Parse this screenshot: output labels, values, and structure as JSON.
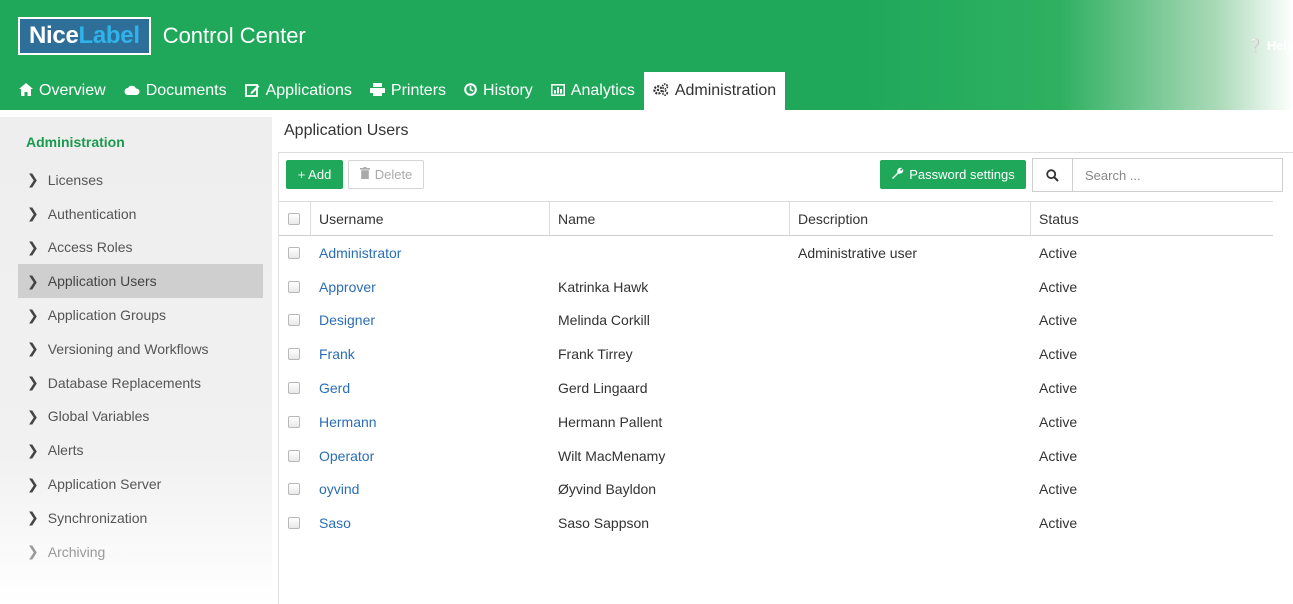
{
  "header": {
    "logo_part1": "Nice",
    "logo_part2": "Label",
    "app_title": "Control Center",
    "help_label": "Help",
    "colors": {
      "brand_green": "#1fa85a",
      "logo_blue": "#2e6f9a",
      "logo_cyan": "#2fb3e8"
    }
  },
  "nav": {
    "tabs": [
      {
        "label": "Overview",
        "icon": "home-icon"
      },
      {
        "label": "Documents",
        "icon": "cloud-icon"
      },
      {
        "label": "Applications",
        "icon": "edit-icon"
      },
      {
        "label": "Printers",
        "icon": "printer-icon"
      },
      {
        "label": "History",
        "icon": "clock-icon"
      },
      {
        "label": "Analytics",
        "icon": "chart-icon"
      },
      {
        "label": "Administration",
        "icon": "gears-icon",
        "active": true
      }
    ]
  },
  "sidebar": {
    "title": "Administration",
    "items": [
      {
        "label": "Licenses"
      },
      {
        "label": "Authentication"
      },
      {
        "label": "Access Roles"
      },
      {
        "label": "Application Users",
        "active": true
      },
      {
        "label": "Application Groups"
      },
      {
        "label": "Versioning and Workflows"
      },
      {
        "label": "Database Replacements"
      },
      {
        "label": "Global Variables"
      },
      {
        "label": "Alerts"
      },
      {
        "label": "Application Server"
      },
      {
        "label": "Synchronization"
      },
      {
        "label": "Archiving",
        "disabled": true
      }
    ]
  },
  "main": {
    "title": "Application Users",
    "toolbar": {
      "add_label": "+ Add",
      "delete_label": "Delete",
      "password_label": "Password settings",
      "search_placeholder": "Search ..."
    },
    "table": {
      "columns": [
        "Username",
        "Name",
        "Description",
        "Status"
      ],
      "rows": [
        {
          "username": "Administrator",
          "name": "",
          "description": "Administrative user",
          "status": "Active"
        },
        {
          "username": "Approver",
          "name": "Katrinka Hawk",
          "description": "",
          "status": "Active"
        },
        {
          "username": "Designer",
          "name": "Melinda Corkill",
          "description": "",
          "status": "Active"
        },
        {
          "username": "Frank",
          "name": "Frank Tirrey",
          "description": "",
          "status": "Active"
        },
        {
          "username": "Gerd",
          "name": "Gerd Lingaard",
          "description": "",
          "status": "Active"
        },
        {
          "username": "Hermann",
          "name": "Hermann Pallent",
          "description": "",
          "status": "Active"
        },
        {
          "username": "Operator",
          "name": "Wilt MacMenamy",
          "description": "",
          "status": "Active"
        },
        {
          "username": "oyvind",
          "name": "Øyvind Bayldon",
          "description": "",
          "status": "Active"
        },
        {
          "username": "Saso",
          "name": "Saso Sappson",
          "description": "",
          "status": "Active"
        }
      ]
    }
  }
}
